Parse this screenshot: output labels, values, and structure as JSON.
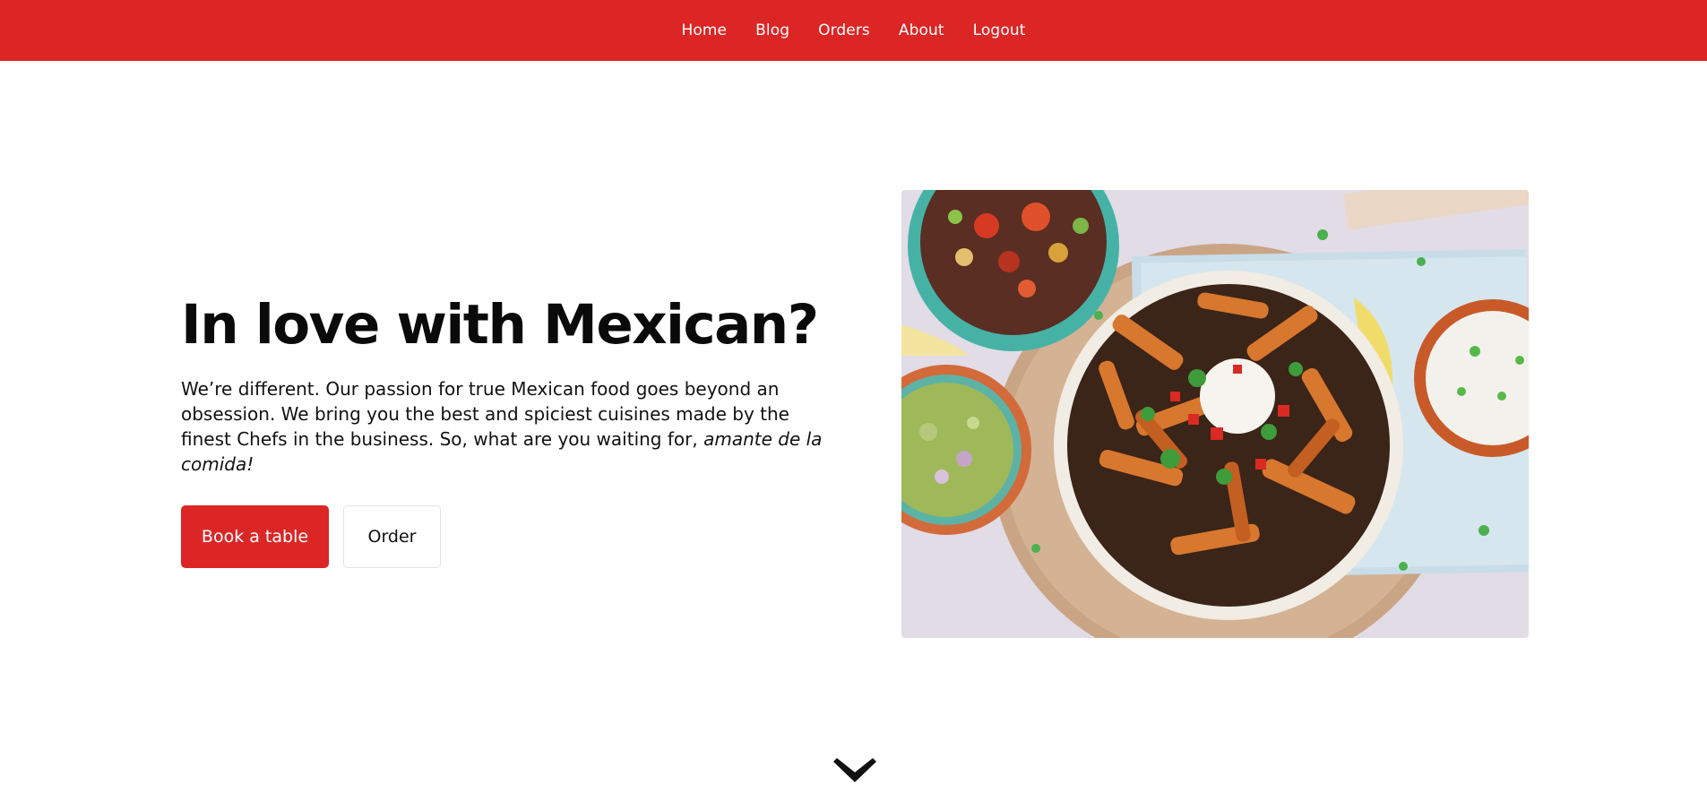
{
  "nav": {
    "items": [
      {
        "label": "Home"
      },
      {
        "label": "Blog"
      },
      {
        "label": "Orders"
      },
      {
        "label": "About"
      },
      {
        "label": "Logout"
      }
    ],
    "background": "#dc2626"
  },
  "hero": {
    "title": "In love with Mexican?",
    "description": "We’re different. Our passion for true Mexican food goes beyond an obsession. We bring you the best and spiciest cuisines made by the finest Chefs in the business. So, what are you waiting for, ",
    "description_emphasis": "amante de la comida!",
    "primary_button": "Book a table",
    "secondary_button": "Order",
    "image_icon": "food-bowl-photo"
  },
  "scroll": {
    "icon": "chevron-down-icon"
  },
  "colors": {
    "accent": "#dc2626",
    "text": "#0a0a0a",
    "background": "#ffffff"
  }
}
